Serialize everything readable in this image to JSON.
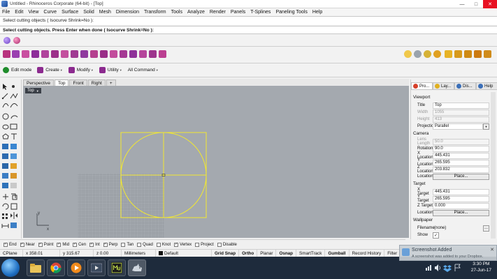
{
  "window": {
    "title": "Untitled - Rhinoceros Corporate (64-bit) - [Top]",
    "min": "—",
    "max": "□",
    "close": "✕"
  },
  "menu": [
    "File",
    "Edit",
    "View",
    "Curve",
    "Surface",
    "Solid",
    "Mesh",
    "Dimension",
    "Transform",
    "Tools",
    "Analyze",
    "Render",
    "Panels",
    "T-Splines",
    "Paneling Tools",
    "Help"
  ],
  "command": {
    "history": "Select cutting objects ( Isocurve  Shrink=No ):",
    "prompt": "Select cutting objects. Press Enter when done ( Isocurve  Shrink=No ):"
  },
  "toolbar3": [
    {
      "label": "Edit mode",
      "icon": "power-icon",
      "color": "#1f8c2b"
    },
    {
      "label": "Create",
      "icon": "create-icon",
      "color": "#8c2a8f"
    },
    {
      "label": "Modify",
      "icon": "modify-icon",
      "color": "#8c2a8f"
    },
    {
      "label": "Utility",
      "icon": "utility-icon",
      "color": "#8c2a8f"
    },
    {
      "label": "All Command",
      "icon": "",
      "color": ""
    }
  ],
  "view_tabs": [
    "Perspective",
    "Top",
    "Front",
    "Right",
    "+"
  ],
  "active_view_tab": "Top",
  "viewport": {
    "label": "Top",
    "axis_y": "y",
    "axis_x": "x"
  },
  "osnap": [
    {
      "label": "End",
      "checked": true
    },
    {
      "label": "Near",
      "checked": true
    },
    {
      "label": "Point",
      "checked": true
    },
    {
      "label": "Mid",
      "checked": true
    },
    {
      "label": "Cen",
      "checked": true
    },
    {
      "label": "Int",
      "checked": true
    },
    {
      "label": "Perp",
      "checked": true
    },
    {
      "label": "Tan",
      "checked": false
    },
    {
      "label": "Quad",
      "checked": false
    },
    {
      "label": "Knot",
      "checked": false
    },
    {
      "label": "Vertex",
      "checked": true
    },
    {
      "label": "Project",
      "checked": false
    },
    {
      "label": "Disable",
      "checked": false
    }
  ],
  "status": {
    "cplane": "CPlane",
    "x": "x 358.01",
    "y": "y 315.67",
    "z": "z 0.00",
    "units": "Millimeters",
    "layer": "Default",
    "buttons": [
      "Grid Snap",
      "Ortho",
      "Planar",
      "Osnap",
      "SmartTrack",
      "Gumball",
      "Record History",
      "Filter"
    ],
    "bold_buttons": [
      "Grid Snap",
      "Ortho",
      "Osnap",
      "Gumball"
    ]
  },
  "right_panel": {
    "tabs": [
      "Pro...",
      "Lay...",
      "Dis...",
      "Help"
    ],
    "sections": {
      "viewport": "Viewport",
      "camera": "Camera",
      "target": "Target",
      "wallpaper": "Wallpaper"
    },
    "viewport_rows": [
      {
        "key": "Title",
        "value": "Top",
        "disabled": false
      },
      {
        "key": "Width",
        "value": "1055",
        "disabled": true
      },
      {
        "key": "Height",
        "value": "413",
        "disabled": true
      },
      {
        "key": "Projection",
        "value": "Parallel",
        "disabled": false
      }
    ],
    "camera_rows": [
      {
        "key": "Lens Length",
        "value": "50.0",
        "disabled": true
      },
      {
        "key": "Rotation",
        "value": "90.0",
        "disabled": false
      },
      {
        "key": "X Location",
        "value": "445.431",
        "disabled": false
      },
      {
        "key": "Y Location",
        "value": "265.595",
        "disabled": false
      },
      {
        "key": "Z Location",
        "value": "203.832",
        "disabled": false
      }
    ],
    "camera_location_key": "Location",
    "place_button": "Place...",
    "target_rows": [
      {
        "key": "X Target",
        "value": "445.431"
      },
      {
        "key": "Y Target",
        "value": "265.595"
      },
      {
        "key": "Z Target",
        "value": "0.000"
      }
    ],
    "target_location_key": "Location",
    "wallpaper_rows": {
      "filename_key": "Filename",
      "filename_value": "(none)",
      "browse": "...",
      "show_key": "Show",
      "show_check": "✓"
    }
  },
  "toast": {
    "title": "Screenshot Added",
    "body": "A screenshot was added to your Dropbox.",
    "close": "✕"
  },
  "clock": {
    "time": "3:30 PM",
    "date": "27-Jun-17"
  },
  "colors": {
    "viewport_bg": "#a4a9af",
    "geometry": "#f2e830",
    "grid": "#8e949a",
    "taskbar": "#1e2b3c"
  }
}
